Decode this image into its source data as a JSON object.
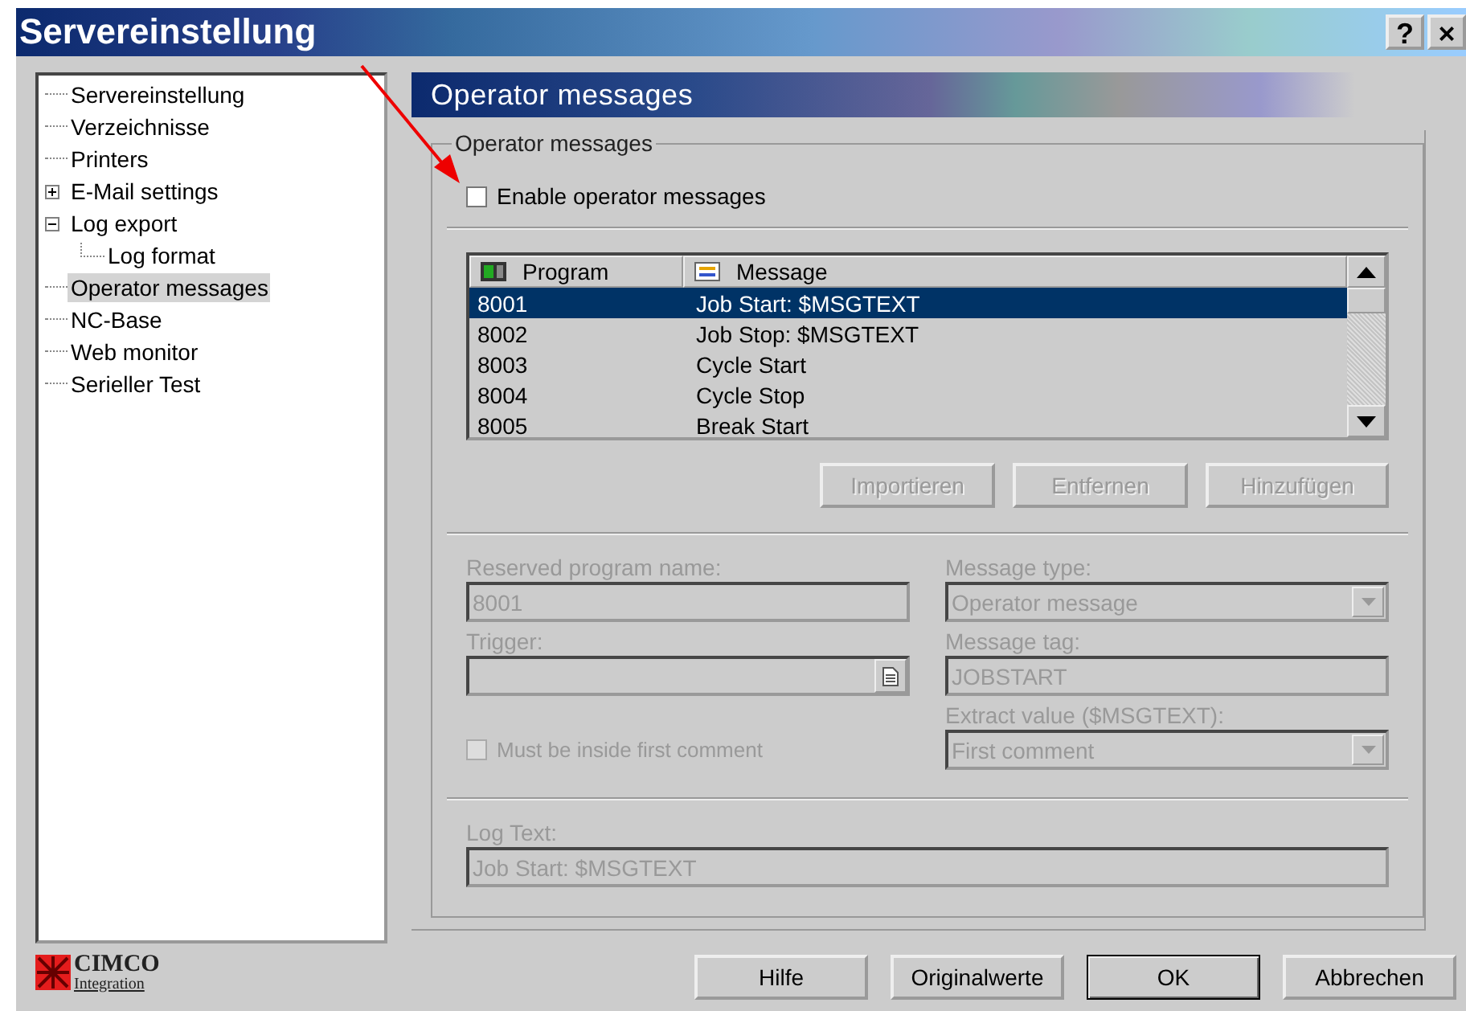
{
  "window": {
    "title": "Servereinstellung",
    "title_buttons": [
      "?",
      "×"
    ]
  },
  "tree": [
    {
      "label": "Servereinstellung",
      "kind": "leaf",
      "selected": false
    },
    {
      "label": "Verzeichnisse",
      "kind": "leaf",
      "selected": false
    },
    {
      "label": "Printers",
      "kind": "leaf",
      "selected": false
    },
    {
      "label": "E-Mail settings",
      "kind": "node",
      "expanded": false,
      "selected": false
    },
    {
      "label": "Log export",
      "kind": "node",
      "expanded": true,
      "selected": false,
      "children": [
        {
          "label": "Log format",
          "kind": "leaf",
          "selected": false
        }
      ]
    },
    {
      "label": "Operator messages",
      "kind": "leaf",
      "selected": true
    },
    {
      "label": "NC-Base",
      "kind": "leaf",
      "selected": false
    },
    {
      "label": "Web monitor",
      "kind": "leaf",
      "selected": false
    },
    {
      "label": "Serieller Test",
      "kind": "leaf",
      "selected": false
    }
  ],
  "panel": {
    "header": "Operator messages",
    "group_title": "Operator messages",
    "enable": {
      "label": "Enable operator messages",
      "checked": false
    },
    "table": {
      "columns": [
        "Program",
        "Message"
      ],
      "rows": [
        {
          "program": "8001",
          "message": "Job Start: $MSGTEXT",
          "selected": true
        },
        {
          "program": "8002",
          "message": "Job Stop: $MSGTEXT",
          "selected": false
        },
        {
          "program": "8003",
          "message": "Cycle Start",
          "selected": false
        },
        {
          "program": "8004",
          "message": "Cycle Stop",
          "selected": false
        },
        {
          "program": "8005",
          "message": "Break Start",
          "selected": false
        }
      ]
    },
    "list_buttons": [
      {
        "label": "Importieren",
        "disabled": true
      },
      {
        "label": "Entfernen",
        "disabled": true
      },
      {
        "label": "Hinzufügen",
        "disabled": true
      }
    ],
    "form": {
      "disabled": true,
      "reserved_program_name": {
        "label": "Reserved program name:",
        "value": "8001"
      },
      "message_type": {
        "label": "Message type:",
        "value": "Operator message"
      },
      "trigger": {
        "label": "Trigger:"
      },
      "message_tag": {
        "label": "Message tag:",
        "value": "JOBSTART"
      },
      "first_comment": {
        "label": "Must be inside first comment",
        "checked": false
      },
      "extract_value": {
        "label": "Extract value ($MSGTEXT):",
        "value": "First comment"
      },
      "log_text": {
        "label": "Log Text:",
        "value": "Job Start: $MSGTEXT"
      }
    }
  },
  "logo": {
    "name": "CIMCO",
    "sub": "Integration"
  },
  "buttons": [
    {
      "label": "Hilfe",
      "default": false
    },
    {
      "label": "Originalwerte",
      "default": false
    },
    {
      "label": "OK",
      "default": true
    },
    {
      "label": "Abbrechen",
      "default": false
    }
  ]
}
